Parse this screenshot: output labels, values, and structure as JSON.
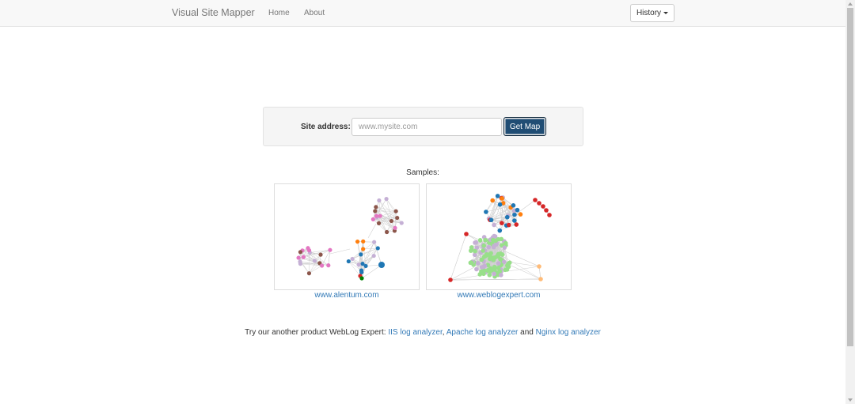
{
  "navbar": {
    "brand": "Visual Site Mapper",
    "links": [
      "Home",
      "About"
    ],
    "history_label": "History"
  },
  "form": {
    "label": "Site address:",
    "placeholder": "www.mysite.com",
    "button_label": "Get Map"
  },
  "samples": {
    "heading": "Samples:",
    "items": [
      "www.alentum.com",
      "www.weblogexpert.com"
    ]
  },
  "footer": {
    "prefix": "Try our another product WebLog Expert: ",
    "links": [
      "IIS log analyzer",
      "Apache log analyzer",
      "Nginx log analyzer"
    ],
    "separator": ", ",
    "conjunction": " and "
  },
  "colors": {
    "brand_blue": "#337ab7",
    "primary_button": "#204d74",
    "graph_pink": "#e377c2",
    "graph_brown": "#8c564b",
    "graph_blue": "#1f77b4",
    "graph_orange": "#ff7f0e",
    "graph_red": "#d62728",
    "graph_green": "#98df8a",
    "graph_lavender": "#c5b0d5"
  }
}
